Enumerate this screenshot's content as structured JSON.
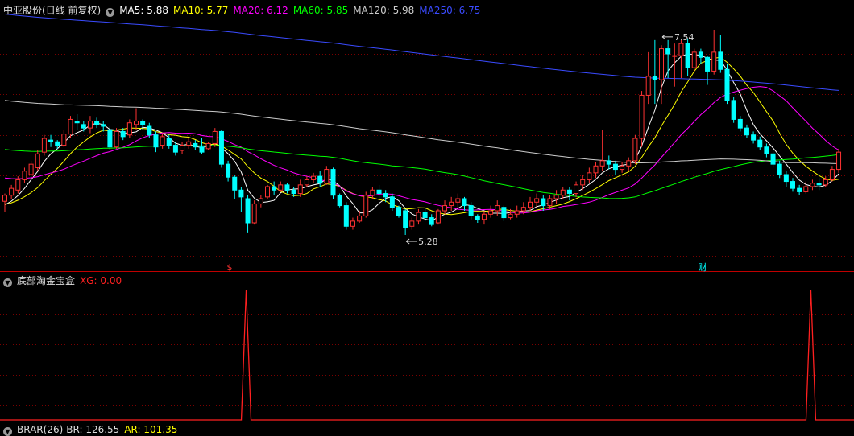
{
  "header": {
    "stock_name": "中亚股份",
    "period": "(日线 前复权)",
    "ma": [
      {
        "label": "MA5: 5.88",
        "color": "#ffffff"
      },
      {
        "label": "MA10: 5.77",
        "color": "#ffff00"
      },
      {
        "label": "MA20: 6.12",
        "color": "#ff00ff"
      },
      {
        "label": "MA60: 5.85",
        "color": "#00ff00"
      },
      {
        "label": "MA120: 5.98",
        "color": "#cccccc"
      },
      {
        "label": "MA250: 6.75",
        "color": "#3a4bff"
      }
    ]
  },
  "indicator": {
    "name": "底部淘金宝盒",
    "value_label": "XG: 0.00",
    "value_color": "#ff2020"
  },
  "bottom_indicator": {
    "name": "BRAR(26)",
    "br_label": "BR: 126.55",
    "ar_label": "AR: 101.35",
    "ar_color": "#ffff00"
  },
  "markers": {
    "dividend": "$",
    "finance": "财"
  },
  "colors": {
    "up": "#ff3232",
    "down": "#00ffff",
    "grid": "#7a0000",
    "signal": "#ff2020"
  },
  "chart_data": {
    "type": "candlestick",
    "price_range": [
      5.0,
      7.8
    ],
    "annotations": [
      {
        "text": "7.54",
        "index": 100,
        "price": 7.54,
        "kind": "high"
      },
      {
        "text": "5.28",
        "index": 61,
        "price": 5.28,
        "kind": "low"
      }
    ],
    "candles": [
      [
        5.67,
        5.74,
        5.55,
        5.76
      ],
      [
        5.74,
        5.82,
        5.7,
        5.86
      ],
      [
        5.8,
        5.92,
        5.76,
        5.96
      ],
      [
        5.92,
        6.02,
        5.88,
        6.06
      ],
      [
        5.98,
        6.1,
        5.95,
        6.14
      ],
      [
        6.06,
        6.22,
        6.02,
        6.26
      ],
      [
        6.24,
        6.4,
        6.2,
        6.44
      ],
      [
        6.38,
        6.36,
        6.3,
        6.44
      ],
      [
        6.36,
        6.32,
        6.28,
        6.38
      ],
      [
        6.32,
        6.45,
        6.3,
        6.5
      ],
      [
        6.45,
        6.62,
        6.4,
        6.66
      ],
      [
        6.6,
        6.58,
        6.5,
        6.68
      ],
      [
        6.56,
        6.52,
        6.48,
        6.6
      ],
      [
        6.52,
        6.6,
        6.46,
        6.66
      ],
      [
        6.6,
        6.56,
        6.52,
        6.64
      ],
      [
        6.56,
        6.54,
        6.48,
        6.6
      ],
      [
        6.5,
        6.3,
        6.26,
        6.54
      ],
      [
        6.3,
        6.48,
        6.28,
        6.52
      ],
      [
        6.48,
        6.42,
        6.38,
        6.52
      ],
      [
        6.44,
        6.58,
        6.4,
        6.62
      ],
      [
        6.56,
        6.6,
        6.5,
        6.75
      ],
      [
        6.6,
        6.56,
        6.5,
        6.62
      ],
      [
        6.54,
        6.44,
        6.4,
        6.58
      ],
      [
        6.44,
        6.3,
        6.24,
        6.48
      ],
      [
        6.32,
        6.42,
        6.28,
        6.46
      ],
      [
        6.4,
        6.32,
        6.28,
        6.44
      ],
      [
        6.32,
        6.24,
        6.2,
        6.36
      ],
      [
        6.26,
        6.32,
        6.22,
        6.36
      ],
      [
        6.32,
        6.36,
        6.28,
        6.4
      ],
      [
        6.34,
        6.3,
        6.26,
        6.38
      ],
      [
        6.3,
        6.24,
        6.22,
        6.4
      ],
      [
        6.28,
        6.34,
        6.26,
        6.36
      ],
      [
        6.34,
        6.48,
        6.3,
        6.52
      ],
      [
        6.48,
        6.1,
        6.06,
        6.5
      ],
      [
        6.1,
        5.95,
        5.9,
        6.14
      ],
      [
        5.95,
        5.8,
        5.7,
        5.98
      ],
      [
        5.8,
        5.72,
        5.55,
        5.84
      ],
      [
        5.7,
        5.42,
        5.3,
        5.74
      ],
      [
        5.42,
        5.64,
        5.4,
        5.68
      ],
      [
        5.64,
        5.7,
        5.6,
        5.74
      ],
      [
        5.72,
        5.84,
        5.7,
        5.86
      ],
      [
        5.84,
        5.8,
        5.74,
        5.9
      ],
      [
        5.8,
        5.86,
        5.78,
        5.9
      ],
      [
        5.86,
        5.8,
        5.76,
        5.88
      ],
      [
        5.8,
        5.76,
        5.72,
        5.84
      ],
      [
        5.76,
        5.86,
        5.72,
        5.92
      ],
      [
        5.86,
        5.92,
        5.84,
        5.96
      ],
      [
        5.92,
        5.96,
        5.88,
        6.0
      ],
      [
        5.96,
        5.88,
        5.84,
        6.02
      ],
      [
        5.88,
        6.04,
        5.86,
        6.08
      ],
      [
        6.04,
        5.74,
        5.7,
        6.06
      ],
      [
        5.74,
        5.62,
        5.6,
        5.76
      ],
      [
        5.62,
        5.38,
        5.34,
        5.66
      ],
      [
        5.38,
        5.44,
        5.34,
        5.48
      ],
      [
        5.44,
        5.5,
        5.42,
        5.56
      ],
      [
        5.5,
        5.74,
        5.48,
        5.78
      ],
      [
        5.74,
        5.8,
        5.7,
        5.84
      ],
      [
        5.8,
        5.76,
        5.7,
        5.86
      ],
      [
        5.76,
        5.72,
        5.66,
        5.8
      ],
      [
        5.72,
        5.6,
        5.56,
        5.76
      ],
      [
        5.6,
        5.5,
        5.48,
        5.62
      ],
      [
        5.56,
        5.36,
        5.28,
        5.58
      ],
      [
        5.38,
        5.44,
        5.34,
        5.48
      ],
      [
        5.44,
        5.54,
        5.4,
        5.58
      ],
      [
        5.54,
        5.48,
        5.44,
        5.6
      ],
      [
        5.48,
        5.4,
        5.38,
        5.52
      ],
      [
        5.42,
        5.56,
        5.4,
        5.58
      ],
      [
        5.56,
        5.62,
        5.52,
        5.68
      ],
      [
        5.62,
        5.66,
        5.56,
        5.72
      ],
      [
        5.66,
        5.7,
        5.6,
        5.76
      ],
      [
        5.7,
        5.62,
        5.56,
        5.72
      ],
      [
        5.62,
        5.5,
        5.46,
        5.66
      ],
      [
        5.5,
        5.46,
        5.42,
        5.52
      ],
      [
        5.46,
        5.52,
        5.4,
        5.56
      ],
      [
        5.52,
        5.56,
        5.48,
        5.62
      ],
      [
        5.56,
        5.62,
        5.5,
        5.68
      ],
      [
        5.6,
        5.48,
        5.44,
        5.62
      ],
      [
        5.48,
        5.52,
        5.46,
        5.58
      ],
      [
        5.52,
        5.56,
        5.48,
        5.62
      ],
      [
        5.56,
        5.6,
        5.52,
        5.66
      ],
      [
        5.6,
        5.66,
        5.56,
        5.72
      ],
      [
        5.66,
        5.7,
        5.6,
        5.76
      ],
      [
        5.7,
        5.62,
        5.56,
        5.74
      ],
      [
        5.62,
        5.7,
        5.58,
        5.74
      ],
      [
        5.7,
        5.74,
        5.64,
        5.8
      ],
      [
        5.74,
        5.8,
        5.7,
        5.84
      ],
      [
        5.8,
        5.76,
        5.68,
        5.84
      ],
      [
        5.76,
        5.86,
        5.72,
        5.9
      ],
      [
        5.86,
        5.92,
        5.8,
        5.98
      ],
      [
        5.92,
        6.0,
        5.88,
        6.06
      ],
      [
        6.0,
        6.08,
        5.94,
        6.12
      ],
      [
        6.08,
        6.14,
        6.02,
        6.5
      ],
      [
        6.14,
        6.1,
        6.04,
        6.2
      ],
      [
        6.1,
        6.04,
        5.98,
        6.14
      ],
      [
        6.04,
        6.08,
        6.0,
        6.12
      ],
      [
        6.08,
        6.14,
        6.02,
        6.18
      ],
      [
        6.14,
        6.4,
        6.1,
        6.44
      ],
      [
        6.4,
        6.9,
        6.3,
        6.95
      ],
      [
        6.9,
        7.12,
        6.8,
        7.4
      ],
      [
        7.12,
        7.08,
        6.8,
        7.54
      ],
      [
        7.08,
        7.44,
        6.8,
        7.48
      ],
      [
        7.44,
        7.38,
        7.1,
        7.54
      ],
      [
        7.36,
        7.36,
        7.0,
        7.5
      ],
      [
        7.36,
        7.5,
        7.1,
        7.54
      ],
      [
        7.5,
        7.22,
        7.12,
        7.56
      ],
      [
        7.22,
        7.4,
        7.18,
        7.44
      ],
      [
        7.4,
        7.34,
        7.26,
        7.44
      ],
      [
        7.34,
        7.18,
        7.02,
        7.36
      ],
      [
        7.18,
        7.4,
        7.14,
        7.66
      ],
      [
        7.4,
        7.2,
        7.16,
        7.6
      ],
      [
        7.2,
        6.84,
        6.8,
        7.26
      ],
      [
        6.84,
        6.62,
        6.58,
        6.88
      ],
      [
        6.62,
        6.52,
        6.48,
        6.66
      ],
      [
        6.52,
        6.44,
        6.4,
        6.56
      ],
      [
        6.44,
        6.38,
        6.34,
        6.48
      ],
      [
        6.38,
        6.3,
        6.26,
        6.42
      ],
      [
        6.3,
        6.22,
        6.18,
        6.34
      ],
      [
        6.22,
        6.1,
        6.06,
        6.26
      ],
      [
        6.1,
        5.98,
        5.94,
        6.14
      ],
      [
        5.98,
        5.9,
        5.84,
        6.02
      ],
      [
        5.9,
        5.82,
        5.78,
        5.94
      ],
      [
        5.82,
        5.78,
        5.74,
        5.86
      ],
      [
        5.78,
        5.84,
        5.76,
        5.9
      ],
      [
        5.84,
        5.88,
        5.8,
        5.92
      ],
      [
        5.88,
        5.86,
        5.8,
        5.94
      ],
      [
        5.86,
        5.92,
        5.84,
        5.96
      ],
      [
        5.92,
        6.04,
        5.9,
        6.08
      ],
      [
        6.04,
        6.24,
        6.0,
        6.28
      ]
    ],
    "signal": {
      "name": "XG",
      "spike_indices": [
        37,
        123
      ]
    },
    "ma_periods": [
      5,
      10,
      20,
      60,
      120,
      250
    ]
  }
}
